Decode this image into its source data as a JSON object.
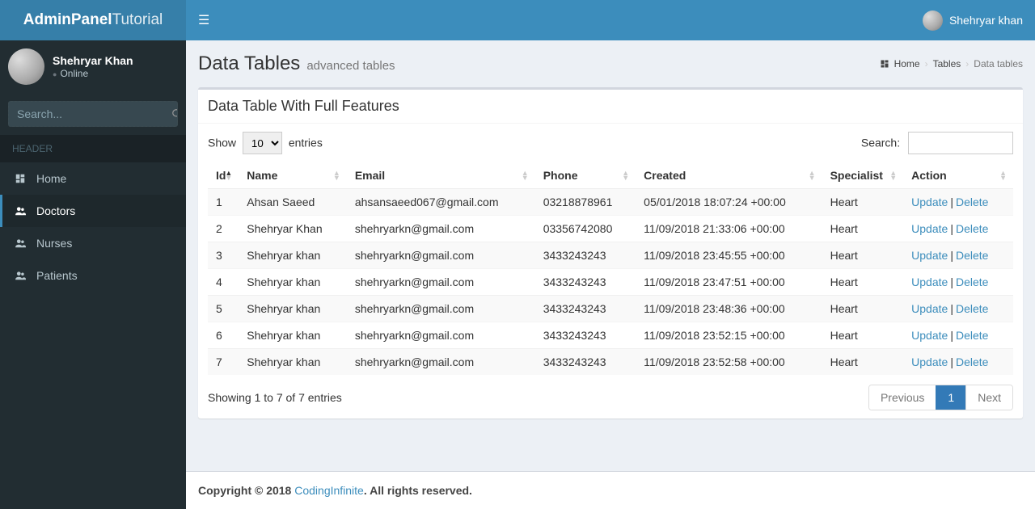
{
  "brand": {
    "strong": "AdminPanel",
    "light": "Tutorial"
  },
  "user": {
    "name": "Shehryar Khan",
    "status": "Online",
    "topbar_name": "Shehryar khan"
  },
  "sidebar": {
    "search_placeholder": "Search...",
    "header": "HEADER",
    "items": [
      {
        "label": "Home",
        "icon": "dashboard"
      },
      {
        "label": "Doctors",
        "icon": "users"
      },
      {
        "label": "Nurses",
        "icon": "users"
      },
      {
        "label": "Patients",
        "icon": "users"
      }
    ],
    "active_index": 1
  },
  "page": {
    "title": "Data Tables",
    "subtitle": "advanced tables",
    "breadcrumb": {
      "home": "Home",
      "tables": "Tables",
      "current": "Data tables"
    }
  },
  "box": {
    "title": "Data Table With Full Features"
  },
  "datatable": {
    "length_prefix": "Show",
    "length_value": "10",
    "length_suffix": "entries",
    "search_label": "Search:",
    "search_value": "",
    "columns": [
      "Id",
      "Name",
      "Email",
      "Phone",
      "Created",
      "Specialist",
      "Action"
    ],
    "rows": [
      {
        "id": "1",
        "name": "Ahsan Saeed",
        "email": "ahsansaeed067@gmail.com",
        "phone": "03218878961",
        "created": "05/01/2018 18:07:24 +00:00",
        "specialist": "Heart"
      },
      {
        "id": "2",
        "name": "Shehryar Khan",
        "email": "shehryarkn@gmail.com",
        "phone": "03356742080",
        "created": "11/09/2018 21:33:06 +00:00",
        "specialist": "Heart"
      },
      {
        "id": "3",
        "name": "Shehryar khan",
        "email": "shehryarkn@gmail.com",
        "phone": "3433243243",
        "created": "11/09/2018 23:45:55 +00:00",
        "specialist": "Heart"
      },
      {
        "id": "4",
        "name": "Shehryar khan",
        "email": "shehryarkn@gmail.com",
        "phone": "3433243243",
        "created": "11/09/2018 23:47:51 +00:00",
        "specialist": "Heart"
      },
      {
        "id": "5",
        "name": "Shehryar khan",
        "email": "shehryarkn@gmail.com",
        "phone": "3433243243",
        "created": "11/09/2018 23:48:36 +00:00",
        "specialist": "Heart"
      },
      {
        "id": "6",
        "name": "Shehryar khan",
        "email": "shehryarkn@gmail.com",
        "phone": "3433243243",
        "created": "11/09/2018 23:52:15 +00:00",
        "specialist": "Heart"
      },
      {
        "id": "7",
        "name": "Shehryar khan",
        "email": "shehryarkn@gmail.com",
        "phone": "3433243243",
        "created": "11/09/2018 23:52:58 +00:00",
        "specialist": "Heart"
      }
    ],
    "actions": {
      "update": "Update",
      "delete": "Delete"
    },
    "info": "Showing 1 to 7 of 7 entries",
    "pagination": {
      "previous": "Previous",
      "page": "1",
      "next": "Next"
    }
  },
  "footer": {
    "copyright_prefix": "Copyright © 2018 ",
    "link": "CodingInfinite",
    "suffix": ". All rights reserved."
  }
}
